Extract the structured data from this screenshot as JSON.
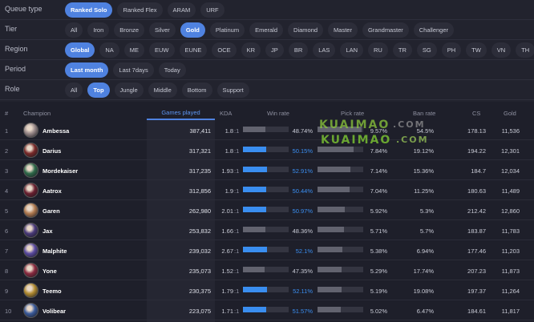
{
  "filters": {
    "queue": {
      "label": "Queue type",
      "options": [
        "Ranked Solo",
        "Ranked Flex",
        "ARAM",
        "URF"
      ],
      "active": "Ranked Solo"
    },
    "tier": {
      "label": "Tier",
      "options": [
        "All",
        "Iron",
        "Bronze",
        "Silver",
        "Gold",
        "Platinum",
        "Emerald",
        "Diamond",
        "Master",
        "Grandmaster",
        "Challenger"
      ],
      "active": "Gold"
    },
    "region": {
      "label": "Region",
      "options": [
        "Global",
        "NA",
        "ME",
        "EUW",
        "EUNE",
        "OCE",
        "KR",
        "JP",
        "BR",
        "LAS",
        "LAN",
        "RU",
        "TR",
        "SG",
        "PH",
        "TW",
        "VN",
        "TH"
      ],
      "active": "Global"
    },
    "period": {
      "label": "Period",
      "options": [
        "Last month",
        "Last 7days",
        "Today"
      ],
      "active": "Last month"
    },
    "role": {
      "label": "Role",
      "options": [
        "All",
        "Top",
        "Jungle",
        "Middle",
        "Bottom",
        "Support"
      ],
      "active": "Top"
    }
  },
  "table": {
    "headers": {
      "rank": "#",
      "champion": "Champion",
      "games": "Games played",
      "kda": "KDA",
      "winrate": "Win rate",
      "pickrate": "Pick rate",
      "banrate": "Ban rate",
      "cs": "CS",
      "gold": "Gold"
    },
    "rows": [
      {
        "rank": "1",
        "champion": "Ambessa",
        "games": "387,411",
        "kda": "1.8",
        "kda_suffix": ":1",
        "winrate": "48.74%",
        "wr_value": 48.74,
        "pickrate": "9.57%",
        "pr_value": 9.57,
        "banrate": "54.5%",
        "cs": "178.13",
        "gold": "11,536",
        "avatar_color": "#9a8a8a"
      },
      {
        "rank": "2",
        "champion": "Darius",
        "games": "317,321",
        "kda": "1.8",
        "kda_suffix": ":1",
        "winrate": "50.15%",
        "wr_value": 50.15,
        "pickrate": "7.84%",
        "pr_value": 7.84,
        "banrate": "19.12%",
        "cs": "194.22",
        "gold": "12,301",
        "avatar_color": "#7a2a2a"
      },
      {
        "rank": "3",
        "champion": "Mordekaiser",
        "games": "317,235",
        "kda": "1.93",
        "kda_suffix": ":1",
        "winrate": "52.91%",
        "wr_value": 52.91,
        "pickrate": "7.14%",
        "pr_value": 7.14,
        "banrate": "15.36%",
        "cs": "184.7",
        "gold": "12,034",
        "avatar_color": "#2f6a4a"
      },
      {
        "rank": "4",
        "champion": "Aatrox",
        "games": "312,856",
        "kda": "1.9",
        "kda_suffix": ":1",
        "winrate": "50.44%",
        "wr_value": 50.44,
        "pickrate": "7.04%",
        "pr_value": 7.04,
        "banrate": "11.25%",
        "cs": "180.63",
        "gold": "11,489",
        "avatar_color": "#6a2030"
      },
      {
        "rank": "5",
        "champion": "Garen",
        "games": "262,980",
        "kda": "2.01",
        "kda_suffix": ":1",
        "winrate": "50.97%",
        "wr_value": 50.97,
        "pickrate": "5.92%",
        "pr_value": 5.92,
        "banrate": "5.3%",
        "cs": "212.42",
        "gold": "12,860",
        "avatar_color": "#b07a50"
      },
      {
        "rank": "6",
        "champion": "Jax",
        "games": "253,832",
        "kda": "1.66",
        "kda_suffix": ":1",
        "winrate": "48.36%",
        "wr_value": 48.36,
        "pickrate": "5.71%",
        "pr_value": 5.71,
        "banrate": "5.7%",
        "cs": "183.87",
        "gold": "11,783",
        "avatar_color": "#4a3a7a"
      },
      {
        "rank": "7",
        "champion": "Malphite",
        "games": "239,032",
        "kda": "2.67",
        "kda_suffix": ":1",
        "winrate": "52.1%",
        "wr_value": 52.1,
        "pickrate": "5.38%",
        "pr_value": 5.38,
        "banrate": "6.94%",
        "cs": "177.46",
        "gold": "11,203",
        "avatar_color": "#5a4aa0"
      },
      {
        "rank": "8",
        "champion": "Yone",
        "games": "235,073",
        "kda": "1.52",
        "kda_suffix": ":1",
        "winrate": "47.35%",
        "wr_value": 47.35,
        "pickrate": "5.29%",
        "pr_value": 5.29,
        "banrate": "17.74%",
        "cs": "207.23",
        "gold": "11,873",
        "avatar_color": "#8a2a40"
      },
      {
        "rank": "9",
        "champion": "Teemo",
        "games": "230,375",
        "kda": "1.79",
        "kda_suffix": ":1",
        "winrate": "52.11%",
        "wr_value": 52.11,
        "pickrate": "5.19%",
        "pr_value": 5.19,
        "banrate": "19.08%",
        "cs": "197.37",
        "gold": "11,264",
        "avatar_color": "#b08a30"
      },
      {
        "rank": "10",
        "champion": "Volibear",
        "games": "223,075",
        "kda": "1.71",
        "kda_suffix": ":1",
        "winrate": "51.57%",
        "wr_value": 51.57,
        "pickrate": "5.02%",
        "pr_value": 5.02,
        "banrate": "6.47%",
        "cs": "184.61",
        "gold": "11,817",
        "avatar_color": "#3a5a9a"
      }
    ]
  },
  "watermark": {
    "line1": "KUAIMAO",
    "line1_suffix": ".COM",
    "line2": "KUAIMAO",
    "line2_suffix": ".COM"
  },
  "colors": {
    "accent": "#4f82e0",
    "win_positive": "#3a8ef0",
    "win_negative": "#62636f",
    "background": "#1e1f2a"
  }
}
